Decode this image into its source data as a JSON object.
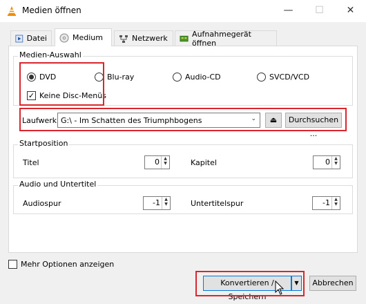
{
  "window": {
    "title": "Medien öffnen",
    "minimize": "—",
    "maximize": "☐",
    "close": "✕"
  },
  "tabs": [
    {
      "label": "Datei",
      "underline": "D"
    },
    {
      "label": "Medium",
      "underline": "M"
    },
    {
      "label": "Netzwerk",
      "underline": "N"
    },
    {
      "label": "Aufnahmegerät öffnen",
      "underline": "A"
    }
  ],
  "media_group": {
    "title": "Medien-Auswahl",
    "options": [
      "DVD",
      "Blu-ray",
      "Audio-CD",
      "SVCD/VCD"
    ],
    "selected": "DVD",
    "no_menus_label": "Keine Disc-Menüs",
    "no_menus_checked": true
  },
  "drive": {
    "label": "Laufwerk",
    "value": "G:\\ - Im Schatten des Triumphbogens",
    "eject_icon": "⏏",
    "browse_label": "Durchsuchen ..."
  },
  "start_group": {
    "title": "Startposition",
    "title_label": "Titel",
    "title_value": "0",
    "chapter_label": "Kapitel",
    "chapter_value": "0"
  },
  "audio_group": {
    "title": "Audio und Untertitel",
    "audio_label": "Audiospur",
    "audio_value": "-1",
    "subtitle_label": "Untertitelspur",
    "subtitle_value": "-1"
  },
  "more_options": {
    "label": "Mehr Optionen anzeigen",
    "checked": false
  },
  "footer": {
    "convert_label": "Konvertieren / Speichern",
    "cancel_label": "Abbrechen"
  },
  "colors": {
    "highlight": "#d9262c",
    "vlc_orange": "#f28c00"
  }
}
